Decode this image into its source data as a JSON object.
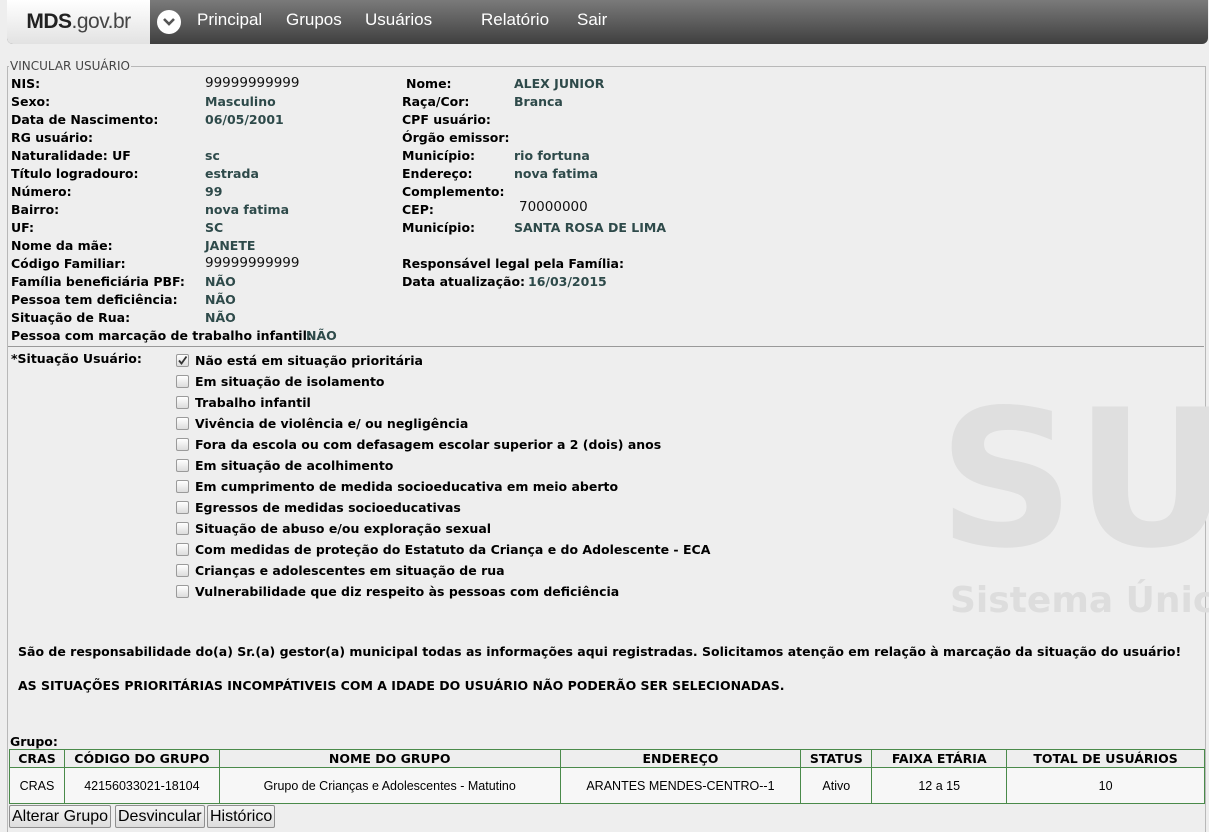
{
  "brand": {
    "bold": "MDS",
    "rest": ".gov.br"
  },
  "nav": [
    "Principal",
    "Grupos",
    "Usuários",
    "Relatório",
    "Sair"
  ],
  "section_title": "VINCULAR USUÁRIO",
  "left_fields": [
    {
      "label": "NIS:",
      "value": "99999999999"
    },
    {
      "label": "Sexo:",
      "value": "Masculino"
    },
    {
      "label": "Data de Nascimento:",
      "value": "06/05/2001"
    },
    {
      "label": "RG usuário:",
      "value": ""
    },
    {
      "label": "Naturalidade: UF",
      "value": "sc"
    },
    {
      "label": "Título logradouro:",
      "value": "estrada"
    },
    {
      "label": "Número:",
      "value": "99"
    },
    {
      "label": "Bairro:",
      "value": "nova fatima"
    },
    {
      "label": "UF:",
      "value": "SC"
    },
    {
      "label": "Nome da mãe:",
      "value": "JANETE"
    },
    {
      "label": "Código Familiar:",
      "value": "99999999999"
    },
    {
      "label": "Família beneficiária PBF:",
      "value": "NÃO"
    },
    {
      "label": "Pessoa tem deficiência:",
      "value": "NÃO"
    },
    {
      "label": "Situação de Rua:",
      "value": "NÃO"
    },
    {
      "label": "Pessoa com marcação de trabalho infantil:",
      "value": "NÃO"
    }
  ],
  "right_fields": [
    {
      "label": "Nome:",
      "value": "ALEX JUNIOR"
    },
    {
      "label": "Raça/Cor:",
      "value": "Branca"
    },
    {
      "label": "CPF usuário:",
      "value": ""
    },
    {
      "label": "Órgão emissor:",
      "value": ""
    },
    {
      "label": "Município:",
      "value": "rio fortuna"
    },
    {
      "label": "Endereço:",
      "value": "nova fatima"
    },
    {
      "label": "Complemento:",
      "value": ""
    },
    {
      "label": "CEP:",
      "value": "70000000"
    },
    {
      "label": "Município:",
      "value": "SANTA ROSA DE LIMA"
    },
    {
      "label": "",
      "value": ""
    },
    {
      "label": "Responsável legal pela Família:",
      "value": ""
    },
    {
      "label": "Data atualização:",
      "value": "16/03/2015"
    }
  ],
  "situacao": {
    "label": "*Situação Usuário:",
    "options": [
      {
        "label": "Não está em situação prioritária",
        "checked": true
      },
      {
        "label": "Em situação de isolamento",
        "checked": false
      },
      {
        "label": "Trabalho infantil",
        "checked": false
      },
      {
        "label": "Vivência de violência e/ ou negligência",
        "checked": false
      },
      {
        "label": "Fora da escola ou com defasagem escolar superior a 2 (dois) anos",
        "checked": false
      },
      {
        "label": "Em situação de acolhimento",
        "checked": false
      },
      {
        "label": "Em cumprimento de medida socioeducativa em meio aberto",
        "checked": false
      },
      {
        "label": "Egressos de medidas socioeducativas",
        "checked": false
      },
      {
        "label": "Situação de abuso e/ou exploração sexual",
        "checked": false
      },
      {
        "label": "Com medidas de proteção do Estatuto da Criança e do Adolescente - ECA",
        "checked": false
      },
      {
        "label": "Crianças e adolescentes em situação de rua",
        "checked": false
      },
      {
        "label": "Vulnerabilidade que diz respeito às pessoas com deficiência",
        "checked": false
      }
    ]
  },
  "notices": [
    "São de responsabilidade do(a) Sr.(a) gestor(a) municipal todas as informações aqui registradas. Solicitamos atenção em relação à marcação da situação do usuário!",
    "AS SITUAÇÕES PRIORITÁRIAS INCOMPÁTIVEIS COM A IDADE DO USUÁRIO NÃO PODERÃO SER SELECIONADAS."
  ],
  "group": {
    "label": "Grupo:",
    "headers": [
      "CRAS",
      "CÓDIGO DO GRUPO",
      "NOME DO GRUPO",
      "ENDEREÇO",
      "STATUS",
      "FAIXA ETÁRIA",
      "TOTAL DE USUÁRIOS"
    ],
    "rows": [
      [
        "CRAS",
        "42156033021-18104",
        "Grupo de Crianças e Adolescentes - Matutino",
        "ARANTES MENDES-CENTRO--1",
        "Ativo",
        "12 a 15",
        "10"
      ]
    ]
  },
  "buttons": {
    "alterar": "Alterar Grupo",
    "desvincular": "Desvincular",
    "historico": "Histórico"
  },
  "watermark": {
    "letters": "SU",
    "caption": "Sistema Único de"
  }
}
